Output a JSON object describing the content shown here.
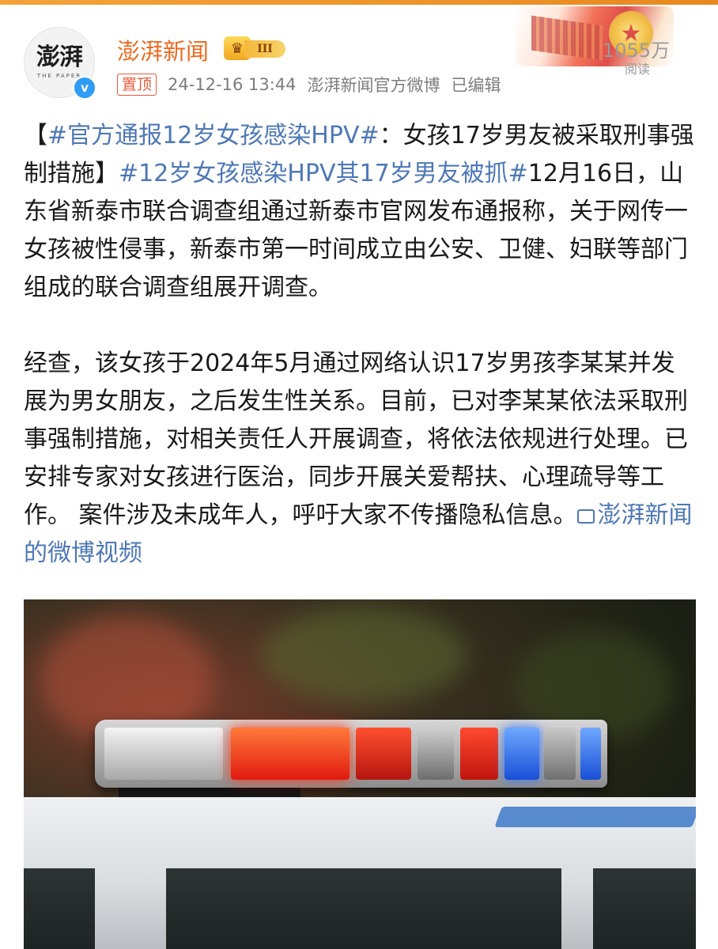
{
  "header": {
    "avatar_text": "澎湃",
    "avatar_sub": "THE PAPER",
    "verified_mark": "v",
    "username": "澎湃新闻",
    "level_label": "III",
    "pin_label": "置顶",
    "timestamp": "24-12-16 13:44",
    "source": "澎湃新闻官方微博",
    "edited_label": "已编辑",
    "read_count": "1055万",
    "read_label": "阅读"
  },
  "post": {
    "topic_1": "#官方通报12岁女孩感染HPV#",
    "text_1": "【",
    "text_2": "：女孩17岁男友被采取刑事强制措施】",
    "topic_2": "#12岁女孩感染HPV其17岁男友被抓#",
    "text_3": "12月16日，山东省新泰市联合调查组通过新泰市官网发布通报称，关于网传一女孩被性侵事，新泰市第一时间成立由公安、卫健、妇联等部门组成的联合调查组展开调查。",
    "paragraph_2": "经查，该女孩于2024年5月通过网络认识17岁男孩李某某并发展为男女朋友，之后发生性关系。目前，已对李某某依法采取刑事强制措施，对相关责任人开展调查，将依法依规进行处理。已安排专家对女孩进行医治，同步开展关爱帮扶、心理疏导等工作。 案件涉及未成年人，呼吁大家不传播隐私信息。",
    "video_link": "澎湃新闻的微博视频"
  },
  "colors": {
    "username": "#ec6a20",
    "link": "#4e78b6",
    "meta": "#7d7d7d",
    "pin": "#e85a3a"
  }
}
